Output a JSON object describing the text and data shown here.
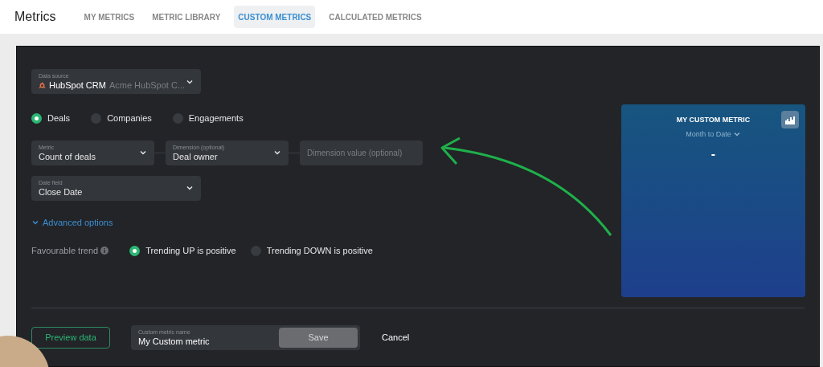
{
  "header": {
    "title": "Metrics"
  },
  "tabs": [
    {
      "label": "MY METRICS",
      "selected": false
    },
    {
      "label": "METRIC LIBRARY",
      "selected": false
    },
    {
      "label": "CUSTOM METRICS",
      "selected": true
    },
    {
      "label": "CALCULATED METRICS",
      "selected": false
    }
  ],
  "data_source": {
    "label": "Data source",
    "value": "HubSpot CRM",
    "account": "Acme HubSpot C..."
  },
  "object_types": [
    {
      "label": "Deals",
      "selected": true
    },
    {
      "label": "Companies",
      "selected": false
    },
    {
      "label": "Engagements",
      "selected": false
    }
  ],
  "metric": {
    "label": "Metric",
    "value": "Count of deals"
  },
  "dimension": {
    "label": "Dimension (optional)",
    "value": "Deal owner"
  },
  "dimension_value": {
    "placeholder": "Dimension value (optional)"
  },
  "date_field": {
    "label": "Date field",
    "value": "Close Date"
  },
  "advanced_options": {
    "label": "Advanced options",
    "expanded": true
  },
  "favourable_trend": {
    "label": "Favourable trend",
    "options": [
      {
        "label": "Trending UP is positive",
        "selected": true
      },
      {
        "label": "Trending DOWN is positive",
        "selected": false
      }
    ]
  },
  "preview": {
    "title": "MY CUSTOM METRIC",
    "period": "Month to Date",
    "value": "-"
  },
  "preview_button": "Preview data",
  "name_field": {
    "label": "Custom metric name",
    "value": "My Custom metric"
  },
  "save_button": "Save",
  "cancel_button": "Cancel"
}
